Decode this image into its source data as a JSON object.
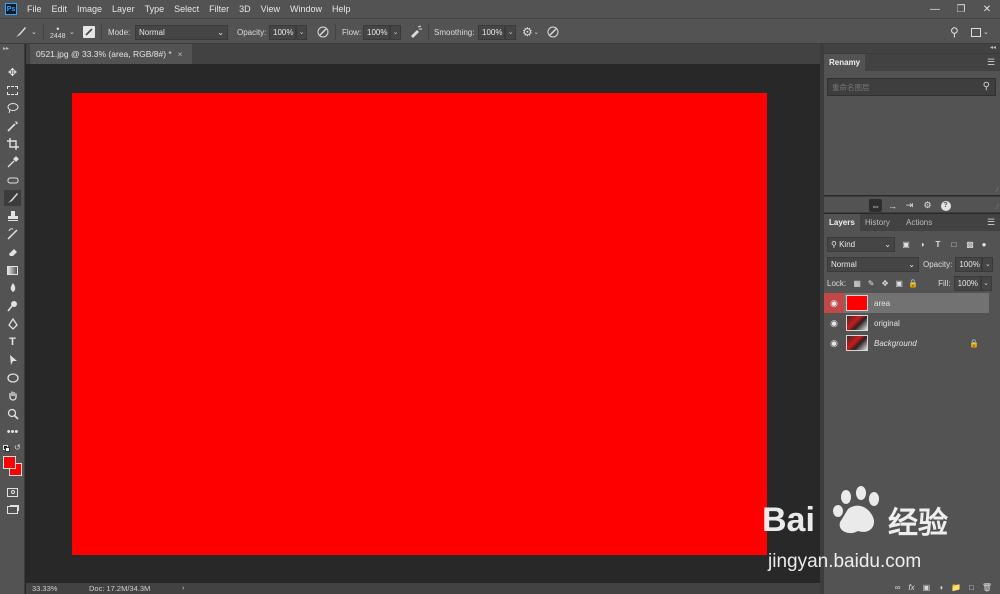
{
  "app": {
    "logo": "Ps"
  },
  "menu": [
    "File",
    "Edit",
    "Image",
    "Layer",
    "Type",
    "Select",
    "Filter",
    "3D",
    "View",
    "Window",
    "Help"
  ],
  "options_bar": {
    "brush_size": "2448",
    "mode_label": "Mode:",
    "mode_value": "Normal",
    "opacity_label": "Opacity:",
    "opacity_value": "100%",
    "flow_label": "Flow:",
    "flow_value": "100%",
    "smoothing_label": "Smoothing:",
    "smoothing_value": "100%"
  },
  "document": {
    "tab_title": "0521.jpg @ 33.3% (area, RGB/8#) *",
    "tab_close": "×",
    "canvas_color": "#ff0000",
    "zoom": "33.33%",
    "doc_info": "Doc: 17.2M/34.3M",
    "status_arrow": "›"
  },
  "rename_panel": {
    "title": "Renamy",
    "search_placeholder": "重命名图层"
  },
  "layers_panel": {
    "tabs": [
      "Layers",
      "History",
      "Actions"
    ],
    "kind_label": "Kind",
    "blend_mode": "Normal",
    "opacity_label": "Opacity:",
    "opacity_value": "100%",
    "lock_label": "Lock:",
    "fill_label": "Fill:",
    "fill_value": "100%",
    "layers": [
      {
        "name": "area",
        "selected": true
      },
      {
        "name": "original",
        "selected": false
      },
      {
        "name": "Background",
        "selected": false
      }
    ],
    "footer_fx": "fx"
  },
  "colors": {
    "foreground": "#ff0000",
    "background": "#ff0000",
    "accent_selected_eye": "#c04848"
  },
  "watermark": {
    "brand": "Bai",
    "brand_suffix": "经验",
    "url": "jingyan.baidu.com"
  }
}
